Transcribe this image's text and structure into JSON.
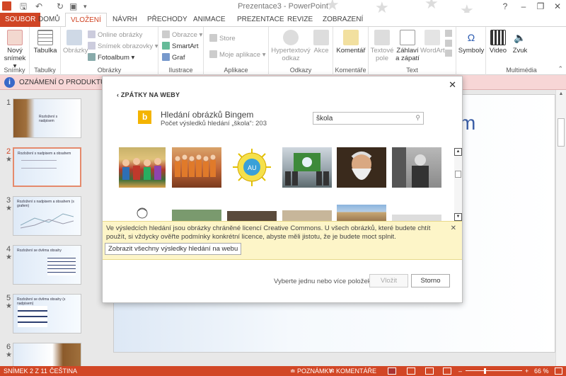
{
  "window": {
    "title": "Prezentace3 - PowerPoint",
    "minimize": "–",
    "restore": "❐",
    "close": "✕",
    "help": "?"
  },
  "tabs": [
    "SOUBOR",
    "DOMŮ",
    "VLOŽENÍ",
    "NÁVRH",
    "PŘECHODY",
    "ANIMACE",
    "PREZENTACE",
    "REVIZE",
    "ZOBRAZENÍ"
  ],
  "ribbon": {
    "new_slide": "Nový\nsnímek",
    "new_slide_l1": "Nový",
    "new_slide_l2": "snímek ▾",
    "table": "Tabulka",
    "images": "Obrázky",
    "online_images": "Online obrázky",
    "screenshot": "Snímek obrazovky ▾",
    "photo_album": "Fotoalbum ▾",
    "shapes": "Obrazce ▾",
    "smartart": "SmartArt",
    "chart": "Graf",
    "store": "Store",
    "my_apps": "Moje aplikace ▾",
    "hyperlink_l1": "Hypertextový",
    "hyperlink_l2": "odkaz",
    "action": "Akce",
    "comment": "Komentář",
    "textbox_l1": "Textové",
    "textbox_l2": "pole",
    "header_l1": "Záhlaví",
    "header_l2": "a zápatí",
    "wordart": "WordArt",
    "symbols": "Symboly",
    "video": "Video",
    "audio": "Zvuk",
    "groups": {
      "slides": "Snímky",
      "tables": "Tabulky",
      "images": "Obrázky",
      "illustrations": "Ilustrace",
      "apps": "Aplikace",
      "links": "Odkazy",
      "comments": "Komentáře",
      "text": "Text",
      "multimedia": "Multimédia"
    }
  },
  "notice": {
    "text": "OZNÁMENÍ O PRODUKTU"
  },
  "slides": [
    {
      "num": "1",
      "title": "Rozložení s\nnadpisem",
      "title_l1": "Rozložení s",
      "title_l2": "nadpisem"
    },
    {
      "num": "2",
      "title": "Rozložení s nadpisem a obsahem"
    },
    {
      "num": "3",
      "title": "Rozložení s nadpisem a obsahem (s grafem)"
    },
    {
      "num": "4",
      "title": "Rozložení se dvěma obsahy"
    },
    {
      "num": "5",
      "title": "Rozložení se dvěma obsahy (s nadpisem)"
    },
    {
      "num": "6",
      "title": ""
    }
  ],
  "slide_title_fragment": "m",
  "dialog": {
    "back": "ZPÁTKY NA WEBY",
    "bing_logo": "b",
    "title": "Hledání obrázků Bingem",
    "result_count": "Počet výsledků hledání „škola“: 203",
    "search_value": "škola",
    "cc_notice": "Ve výsledcích hledání jsou obrázky chráněné licencí Creative Commons. U všech obrázků, které budete chtít použít, si vždycky ověřte podmínky konkrétní licence, abyste měli jistotu, že je budete moct splnit.",
    "show_all": "Zobrazit všechny výsledky hledání na webu",
    "select_hint": "Vyberte jednu nebo více položek.",
    "insert": "Vložit",
    "cancel": "Storno"
  },
  "status": {
    "slide": "SNÍMEK 2 Z 11",
    "language": "ČEŠTINA",
    "notes": "POZNÁMKY",
    "comments": "KOMENTÁŘE",
    "zoom": "66 %"
  },
  "colors": {
    "accent": "#d24726",
    "bing": "#f4b400",
    "notice_bg": "#f7d6d6",
    "cc_bg": "#fdf5c8"
  }
}
